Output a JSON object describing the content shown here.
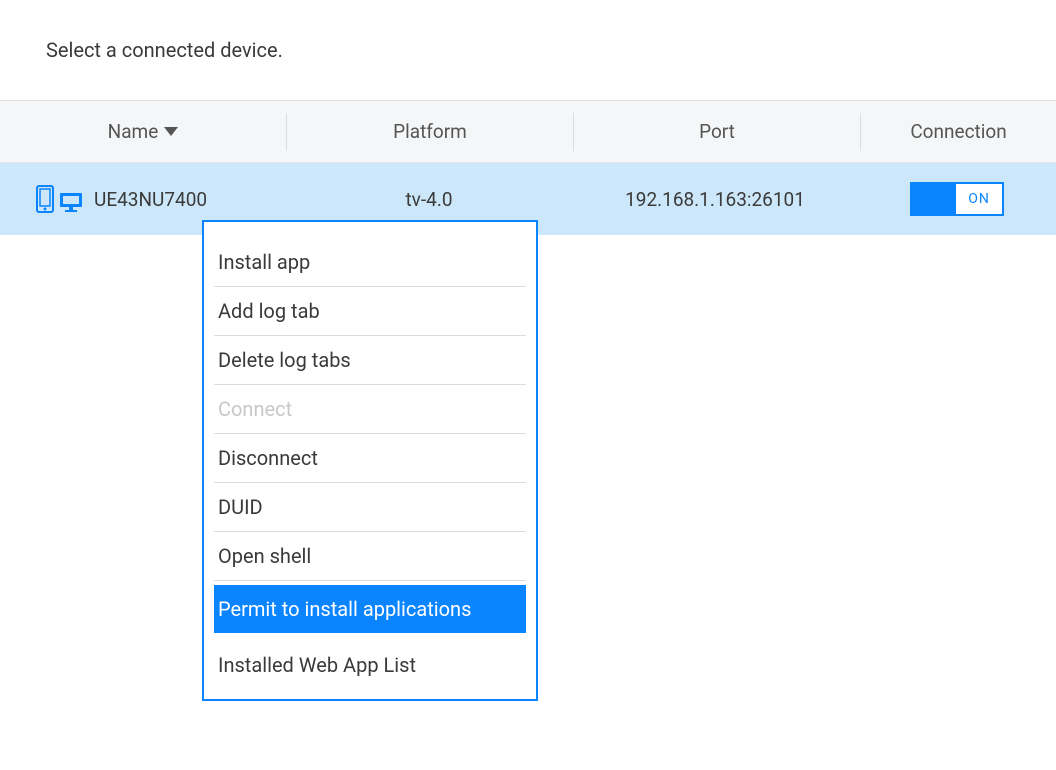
{
  "header": {
    "prompt": "Select a connected device."
  },
  "columns": {
    "name": "Name",
    "platform": "Platform",
    "port": "Port",
    "connection": "Connection"
  },
  "device": {
    "name": "UE43NU7400",
    "platform": "tv-4.0",
    "port": "192.168.1.163:26101",
    "toggle_label": "ON"
  },
  "menu": {
    "install_app": "Install app",
    "add_log_tab": "Add log tab",
    "delete_log_tabs": "Delete log tabs",
    "connect": "Connect",
    "disconnect": "Disconnect",
    "duid": "DUID",
    "open_shell": "Open shell",
    "permit_install": "Permit to install applications",
    "installed_list": "Installed Web App List"
  },
  "colors": {
    "accent": "#0a84ff",
    "row_selected": "#cce7fa"
  }
}
